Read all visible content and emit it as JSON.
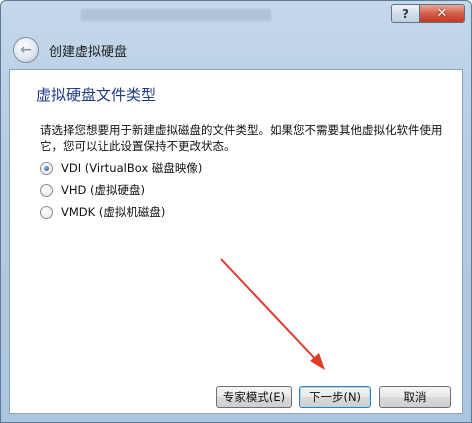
{
  "window": {
    "help_label": "?",
    "close_label": "✕"
  },
  "nav": {
    "title": "创建虚拟硬盘",
    "back_icon": "back-arrow-icon"
  },
  "page": {
    "heading": "虚拟硬盘文件类型",
    "description": "请选择您想要用于新建虚拟磁盘的文件类型。如果您不需要其他虚拟化软件使用它，您可以让此设置保持不更改状态。"
  },
  "options": [
    {
      "label": "VDI (VirtualBox 磁盘映像)",
      "checked": true
    },
    {
      "label": "VHD (虚拟硬盘)",
      "checked": false
    },
    {
      "label": "VMDK (虚拟机磁盘)",
      "checked": false
    }
  ],
  "buttons": {
    "expert": "专家模式(E)",
    "next": "下一步(N)",
    "cancel": "取消"
  },
  "colors": {
    "arrow": "#e03a2a",
    "heading": "#1e3a8c"
  }
}
